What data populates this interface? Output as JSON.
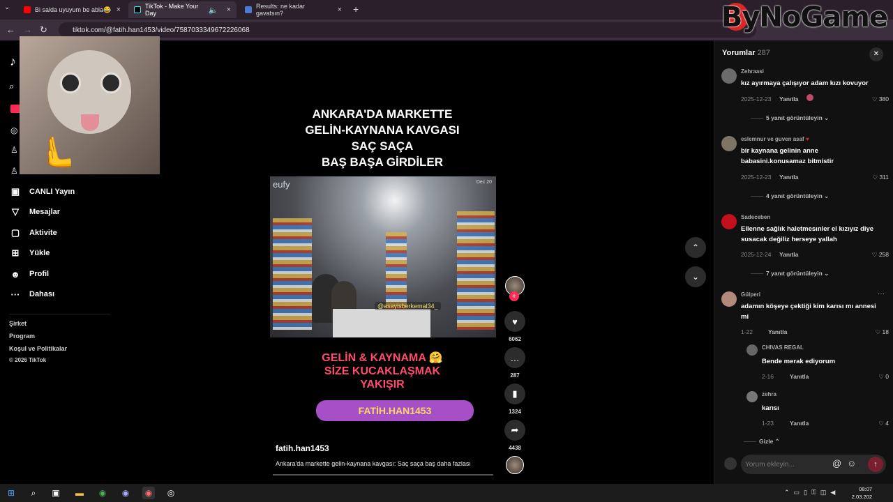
{
  "browser": {
    "tabs": [
      {
        "label": "Bi salda uyuyum be abla😂 - Yo",
        "active": false
      },
      {
        "label": "TikTok - Make Your Day",
        "active": true
      },
      {
        "label": "Results: ne kadar gavatsın?",
        "active": false
      }
    ],
    "url": "tiktok.com/@fatih.han1453/video/7587033349672226068",
    "watermark": "ByNoGame"
  },
  "sidebar": {
    "items": [
      {
        "label": "CANLI Yayın",
        "icon": "live-icon"
      },
      {
        "label": "Mesajlar",
        "icon": "send-icon"
      },
      {
        "label": "Aktivite",
        "icon": "activity-icon"
      },
      {
        "label": "Yükle",
        "icon": "upload-icon"
      },
      {
        "label": "Profil",
        "icon": "profile-icon"
      },
      {
        "label": "Dahası",
        "icon": "more-icon"
      }
    ],
    "footer": [
      "Şirket",
      "Program",
      "Koşul ve Politikalar",
      "© 2026 TikTok"
    ]
  },
  "video": {
    "title_lines": [
      "ANKARA'DA MARKETTE",
      "GELİN-KAYNANA KAVGASI",
      "SAÇ SAÇA",
      "BAŞ BAŞA GİRDİLER"
    ],
    "cam_brand": "eufy",
    "cam_date": "Dec 20",
    "cam_handle": "@asayisberkemal34_",
    "caption_lines": [
      "GELİN & KAYNAMA 🤗",
      "SİZE KUCAKLAŞMAK",
      "YAKIŞIR"
    ],
    "brush_text": "FATİH.HAN1453",
    "author": "fatih.han1453",
    "description": "Ankara'da markette gelin-kaynana kavgası: Saç saça baş  daha fazlası"
  },
  "actions": {
    "likes": "6062",
    "comments": "287",
    "saves": "1324",
    "shares": "4438"
  },
  "comments_panel": {
    "title": "Yorumlar",
    "count": "287",
    "reply_label": "Yanıtla",
    "comments": [
      {
        "user": "Zehraasl",
        "text": "kız ayırmaya çalışıyor adam kızı kovuyor",
        "date": "2025-12-23",
        "likes": "380",
        "more": "5 yanıt görüntüleyin"
      },
      {
        "user": "eslemnur ve guven asaf",
        "text": "bir kaynana gelinin anne babasini.konusamaz bitmistir",
        "date": "2025-12-23",
        "likes": "311",
        "more": "4 yanıt görüntüleyin"
      },
      {
        "user": "Sadeceben",
        "text": "Ellenne sağlık haletmesınler el kızıyız diye susacak değiliz herseye yallah",
        "date": "2025-12-24",
        "likes": "258",
        "more": "7 yanıt görüntüleyin"
      },
      {
        "user": "Gülperi",
        "text": "adamın köşeye çektiği kim karısı mı annesi mi",
        "date": "1-22",
        "likes": "18"
      }
    ],
    "replies": [
      {
        "user": "CHIVAS REGAL",
        "text": "Bende merak ediyorum",
        "date": "2-16",
        "likes": "0"
      },
      {
        "user": "zehra",
        "text": "karısı",
        "date": "1-23",
        "likes": "4"
      }
    ],
    "hide_label": "Gizle",
    "compose_placeholder": "Yorum ekleyin..."
  },
  "taskbar": {
    "time": "08:07",
    "date": "2.03.202"
  }
}
